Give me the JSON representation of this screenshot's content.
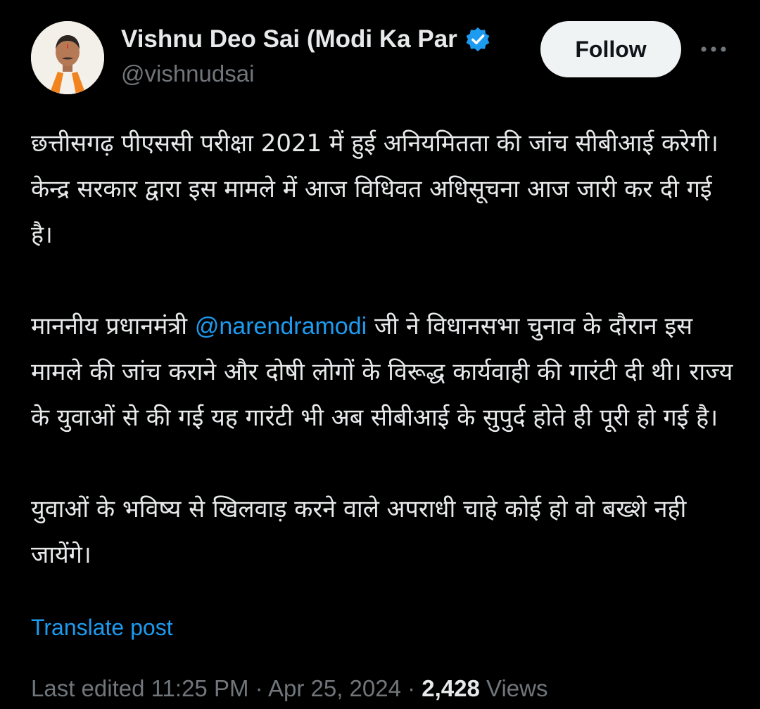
{
  "post": {
    "author": {
      "display_name": "Vishnu Deo Sai (Modi Ka Par",
      "handle": "@vishnudsai",
      "verified_icon": "verified-badge-icon",
      "avatar_icon": "avatar-photo"
    },
    "follow_label": "Follow",
    "more_icon": "more-options-icon",
    "paragraphs": {
      "p1": "छत्तीसगढ़ पीएससी परीक्षा 2021 में हुई अनियमितता की जांच सीबीआई करेगी। केन्द्र सरकार द्वारा इस मामले में आज विधिवत अधिसूचना आज जारी कर दी गई है।",
      "p2_before": "माननीय प्रधानमंत्री ",
      "p2_mention": "@narendramodi",
      "p2_after": " जी ने विधानसभा चुनाव के दौरान इस मामले की जांच कराने और दोषी लोगों के विरूद्ध कार्यवाही की गारंटी दी थी। राज्य के युवाओं से की गई यह गारंटी भी अब सीबीआई के सुपुर्द होते ही पूरी हो गई है।",
      "p3": "युवाओं के भविष्य से खिलवाड़ करने वाले अपराधी चाहे कोई हो वो बख्शे नही जायेंगे।"
    },
    "translate_label": "Translate post",
    "meta": {
      "edited_prefix": "Last edited",
      "time": "11:25 PM",
      "separator": " · ",
      "date": "Apr 25, 2024",
      "views_count": "2,428",
      "views_label": "Views"
    },
    "colors": {
      "background": "#000000",
      "text": "#e7e9ea",
      "secondary": "#71767b",
      "accent": "#1d9bf0",
      "follow_bg": "#eff3f4"
    }
  }
}
